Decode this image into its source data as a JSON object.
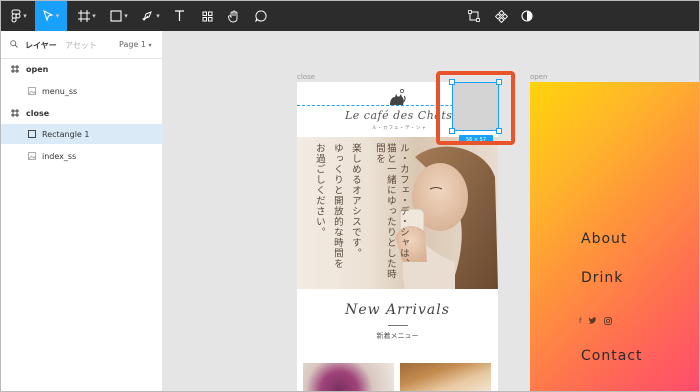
{
  "toolbar": {
    "icons": [
      "figma-menu-icon",
      "move-tool-icon",
      "frame-tool-icon",
      "shape-tool-icon",
      "pen-tool-icon",
      "text-tool-icon",
      "components-icon",
      "hand-tool-icon",
      "comment-icon",
      "edit-object-icon",
      "create-component-icon",
      "mask-icon"
    ],
    "accent": "#18a0fb"
  },
  "panel": {
    "tab_layers": "レイヤー",
    "tab_assets": "アセット",
    "page": "Page 1",
    "layers": [
      {
        "label": "open",
        "kind": "frame"
      },
      {
        "label": "menu_ss",
        "kind": "image"
      },
      {
        "label": "close",
        "kind": "frame"
      },
      {
        "label": "Rectangle 1",
        "kind": "rectangle",
        "selected": true
      },
      {
        "label": "index_ss",
        "kind": "image"
      }
    ]
  },
  "canvas": {
    "frame_close_label": "close",
    "frame_open_label": "open",
    "logo": "Le café des Chats",
    "logo_sub": "ル・カフェ・デ・シャ",
    "hero_col1": "ル・カフェ・デ・シャは、",
    "hero_col2": "猫と一緒にゆったりとした時間を",
    "hero_col3": "楽しめるオアシスです。",
    "hero_col4": "ゆっくりと開放的な時間を",
    "hero_col5": "お過ごしください。",
    "arrivals_title": "New Arrivals",
    "arrivals_sub": "新着メニュー",
    "selection_dims": "56 × 57",
    "menu": {
      "about": "About",
      "drink": "Drink",
      "contact": "Contact",
      "socials": [
        "f",
        "twitter",
        "instagram"
      ]
    },
    "highlight_color": "#e8532b"
  }
}
